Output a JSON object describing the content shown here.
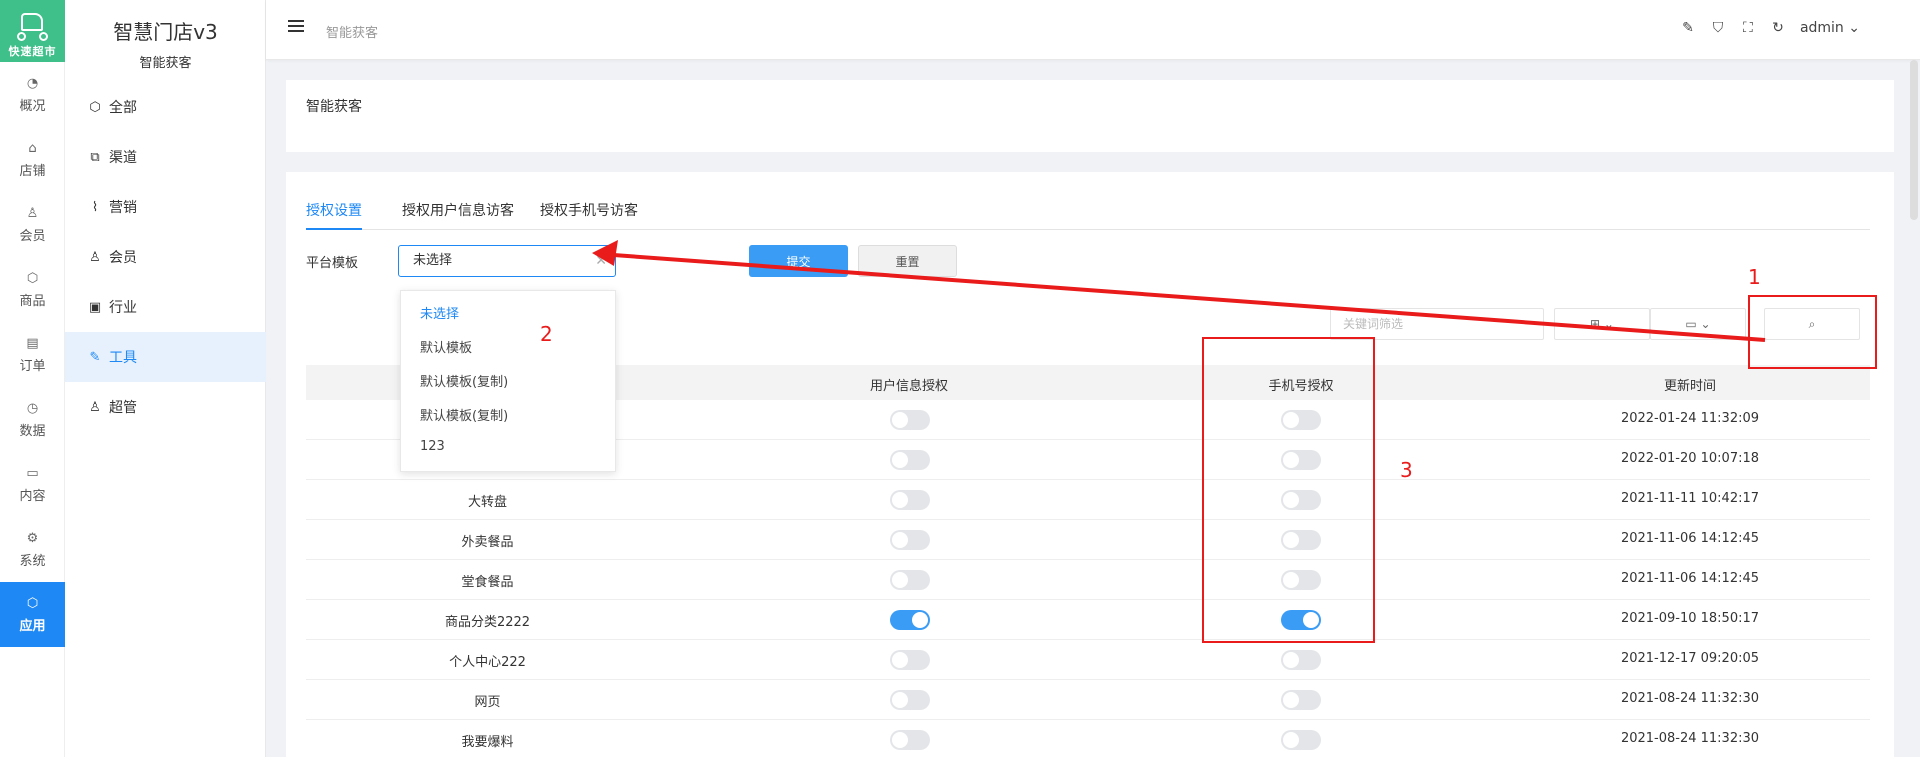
{
  "logo": {
    "text": "快速超市"
  },
  "rail": [
    {
      "icon": "gauge-icon",
      "glyph": "◔",
      "label": "概况"
    },
    {
      "icon": "store-icon",
      "glyph": "⌂",
      "label": "店铺"
    },
    {
      "icon": "user-icon",
      "glyph": "♙",
      "label": "会员"
    },
    {
      "icon": "cube-icon",
      "glyph": "⬡",
      "label": "商品"
    },
    {
      "icon": "clipboard-icon",
      "glyph": "▤",
      "label": "订单"
    },
    {
      "icon": "clock-icon",
      "glyph": "◷",
      "label": "数据"
    },
    {
      "icon": "folder-icon",
      "glyph": "▭",
      "label": "内容"
    },
    {
      "icon": "gear-icon",
      "glyph": "⚙",
      "label": "系统"
    },
    {
      "icon": "app-icon",
      "glyph": "⬡",
      "label": "应用",
      "active": true
    }
  ],
  "sidebar": {
    "brand": "智慧门店v3",
    "subtitle": "智能获客",
    "items": [
      {
        "icon": "cube-icon",
        "glyph": "⬡",
        "label": "全部"
      },
      {
        "icon": "channel-icon",
        "glyph": "⧉",
        "label": "渠道"
      },
      {
        "icon": "chart-icon",
        "glyph": "⌇",
        "label": "营销"
      },
      {
        "icon": "member-icon",
        "glyph": "♙",
        "label": "会员"
      },
      {
        "icon": "briefcase-icon",
        "glyph": "▣",
        "label": "行业"
      },
      {
        "icon": "wrench-icon",
        "glyph": "✎",
        "label": "工具",
        "active": true
      },
      {
        "icon": "admin-user-icon",
        "glyph": "♙",
        "label": "超管"
      }
    ]
  },
  "header": {
    "breadcrumb": "智能获客",
    "user": "admin"
  },
  "page": {
    "title": "智能获客"
  },
  "tabs": [
    "授权设置",
    "授权用户信息访客",
    "授权手机号访客"
  ],
  "form": {
    "label": "平台模板",
    "select_value": "未选择",
    "submit_label": "提交",
    "reset_label": "重置"
  },
  "dropdown": {
    "options": [
      "未选择",
      "默认模板",
      "默认模板(复制)",
      "默认模板(复制)",
      "123"
    ],
    "selected_index": 0
  },
  "filter": {
    "placeholder": "关键词筛选"
  },
  "table": {
    "headers": [
      "用户信息授权",
      "手机号授权",
      "更新时间"
    ],
    "rows": [
      {
        "name": "",
        "user_auth": false,
        "phone_auth": false,
        "time": "2022-01-24 11:32:09"
      },
      {
        "name": "",
        "user_auth": false,
        "phone_auth": false,
        "time": "2022-01-20 10:07:18"
      },
      {
        "name": "大转盘",
        "user_auth": false,
        "phone_auth": false,
        "time": "2021-11-11 10:42:17"
      },
      {
        "name": "外卖餐品",
        "user_auth": false,
        "phone_auth": false,
        "time": "2021-11-06 14:12:45"
      },
      {
        "name": "堂食餐品",
        "user_auth": false,
        "phone_auth": false,
        "time": "2021-11-06 14:12:45"
      },
      {
        "name": "商品分类2222",
        "user_auth": true,
        "phone_auth": true,
        "time": "2021-09-10 18:50:17"
      },
      {
        "name": "个人中心222",
        "user_auth": false,
        "phone_auth": false,
        "time": "2021-12-17 09:20:05"
      },
      {
        "name": "网页",
        "user_auth": false,
        "phone_auth": false,
        "time": "2021-08-24 11:32:30"
      },
      {
        "name": "我要爆料",
        "user_auth": false,
        "phone_auth": false,
        "time": "2021-08-24 11:32:30"
      }
    ]
  },
  "annotations": [
    "1",
    "2",
    "3"
  ],
  "colors": {
    "accent": "#1e88f5",
    "logo_bg": "#3fbf8a",
    "annotation": "#e91b1b"
  }
}
